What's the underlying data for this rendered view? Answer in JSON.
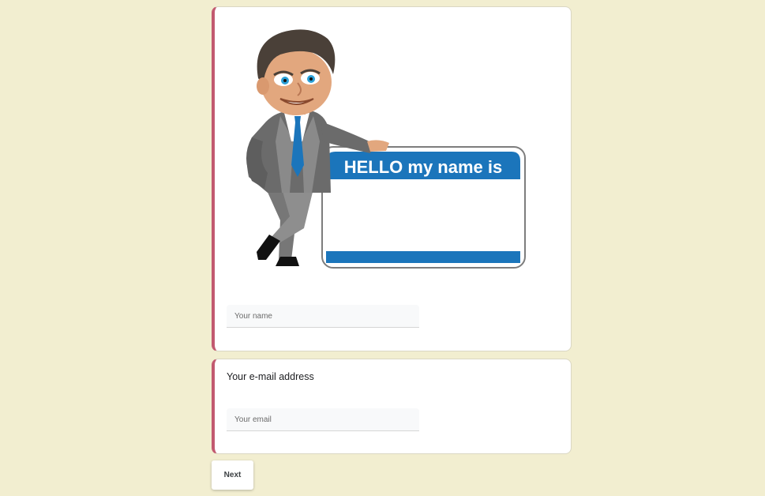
{
  "form": {
    "name_section": {
      "image_alt": "Cartoon man leaning on a name tag sticker",
      "sticker_text": "HELLO my name is",
      "name_input_value": "",
      "name_input_placeholder": "Your name"
    },
    "email_section": {
      "title": "Your e-mail address",
      "email_input_value": "",
      "email_input_placeholder": "Your email"
    },
    "next_label": "Next"
  },
  "colors": {
    "page_background": "#f2eed0",
    "card_accent": "#c25a70",
    "sticker_blue": "#1b75bb"
  }
}
